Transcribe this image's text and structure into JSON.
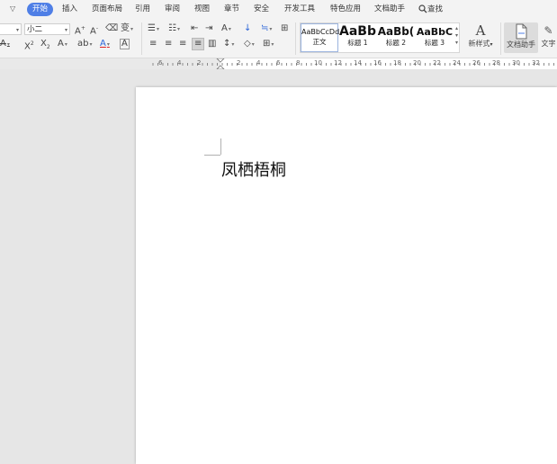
{
  "menubar": {
    "items": [
      "开始",
      "插入",
      "页面布局",
      "引用",
      "审阅",
      "视图",
      "章节",
      "安全",
      "开发工具",
      "特色应用",
      "文档助手"
    ],
    "search_label": "查找"
  },
  "ribbon": {
    "font_name": "",
    "font_size": "小二",
    "styles": [
      {
        "sample": "AaBbCcDd",
        "name": "正文"
      },
      {
        "sample": "AaBb",
        "name": "标题 1"
      },
      {
        "sample": "AaBb(",
        "name": "标题 2"
      },
      {
        "sample": "AaBbC",
        "name": "标题 3"
      }
    ],
    "new_style_label": "新样式",
    "doc_assistant_label": "文档助手",
    "text_tools_label": "文字"
  },
  "ruler": {
    "labels": [
      "6",
      "4",
      "2",
      "2",
      "4",
      "6",
      "8",
      "10",
      "12",
      "14",
      "16",
      "18",
      "20",
      "22",
      "24",
      "26",
      "28",
      "30",
      "32"
    ]
  },
  "document": {
    "body_text": "凤栖梧桐"
  },
  "colors": {
    "accent": "#4f7fe6",
    "font_color_red": "#e02020",
    "font_color_blue": "#2b64d8"
  }
}
